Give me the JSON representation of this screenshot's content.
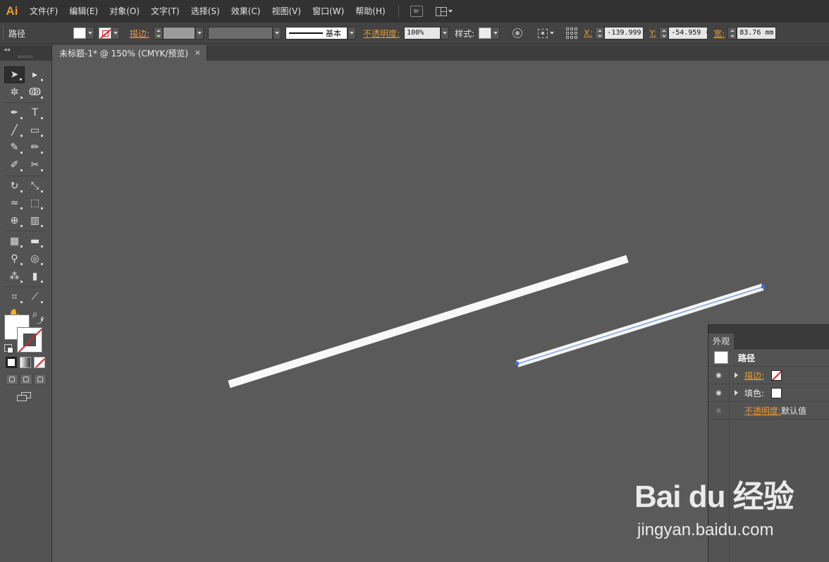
{
  "app": {
    "logo": "Ai"
  },
  "menu": {
    "items": [
      "文件(F)",
      "编辑(E)",
      "对象(O)",
      "文字(T)",
      "选择(S)",
      "效果(C)",
      "视图(V)",
      "窗口(W)",
      "帮助(H)"
    ],
    "bridge_label": "Br"
  },
  "control": {
    "selection_type": "路径",
    "stroke_label": "描边:",
    "stroke_profile": "基本",
    "opacity_label": "不透明度:",
    "opacity_value": "100%",
    "style_label": "样式:",
    "x_label": "X:",
    "x_value": "-139.999",
    "y_label": "Y:",
    "y_value": "-54.959 (",
    "w_label": "宽:",
    "w_value": "83.76 mm"
  },
  "document": {
    "tab_title": "未标题-1* @ 150% (CMYK/预览)",
    "close_glyph": "×"
  },
  "tools": [
    [
      "selection-tool",
      "direct-selection-tool"
    ],
    [
      "magic-wand-tool",
      "lasso-tool"
    ],
    [
      "pen-tool",
      "type-tool"
    ],
    [
      "line-segment-tool",
      "rectangle-tool"
    ],
    [
      "paintbrush-tool",
      "pencil-tool"
    ],
    [
      "blob-brush-tool",
      "scissors-tool"
    ],
    [
      "rotate-tool",
      "scale-tool"
    ],
    [
      "warp-tool",
      "free-transform-tool"
    ],
    [
      "shape-builder-tool",
      "perspective-grid-tool"
    ],
    [
      "mesh-tool",
      "gradient-tool"
    ],
    [
      "eyedropper-tool",
      "blend-tool"
    ],
    [
      "symbol-sprayer-tool",
      "column-graph-tool"
    ],
    [
      "artboard-tool",
      "slice-tool"
    ],
    [
      "hand-tool",
      "zoom-tool"
    ]
  ],
  "appearance": {
    "panel_tab": "外观",
    "object_title": "路径",
    "stroke_label": "描边:",
    "fill_label": "填色:",
    "opacity_label": "不透明度:",
    "opacity_value": "默认值"
  },
  "watermark": {
    "brand": "Bai du 经验",
    "url": "jingyan.baidu.com"
  },
  "colors": {
    "accent_orange": "#e79a36",
    "selection_blue": "#3b6fe0",
    "canvas": "#5a5a5a"
  }
}
